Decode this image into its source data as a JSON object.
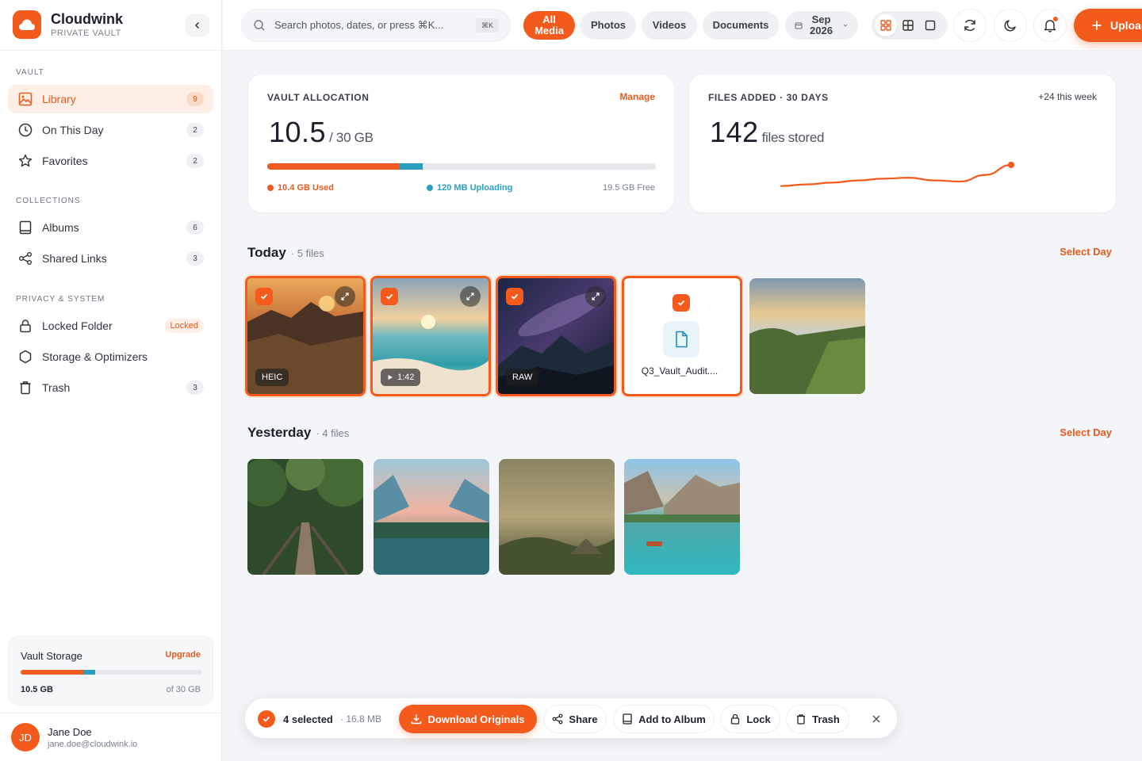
{
  "brand": {
    "name": "Cloudwink",
    "subtitle": "PRIVATE VAULT"
  },
  "sidebar": {
    "sections": [
      {
        "label": "VAULT"
      },
      {
        "label": "COLLECTIONS"
      },
      {
        "label": "PRIVACY & SYSTEM"
      }
    ],
    "items": [
      {
        "label": "Library",
        "badge": "9",
        "icon": "image-icon",
        "active": true
      },
      {
        "label": "On This Day",
        "badge": "2",
        "icon": "clock-icon"
      },
      {
        "label": "Favorites",
        "badge": "2",
        "icon": "star-icon"
      },
      {
        "label": "Albums",
        "badge": "6",
        "icon": "album-icon"
      },
      {
        "label": "Shared Links",
        "badge": "3",
        "icon": "share-icon"
      },
      {
        "label": "Locked Folder",
        "badge": "Locked",
        "icon": "lock-icon"
      },
      {
        "label": "Storage & Optimizers",
        "icon": "hexagon-icon"
      },
      {
        "label": "Trash",
        "badge": "3",
        "icon": "trash-icon"
      }
    ],
    "storage": {
      "title": "Vault Storage",
      "upgrade": "Upgrade",
      "used_label": "10.5 GB",
      "total_label": "of 30 GB",
      "used_fraction": 0.35,
      "uploading_fraction": 0.06
    },
    "user": {
      "initials": "JD",
      "name": "Jane Doe",
      "email": "jane.doe@cloudwink.io"
    }
  },
  "topbar": {
    "search_placeholder": "Search photos, dates, or press ⌘K...",
    "shortcut": "⌘K",
    "filters": [
      {
        "line1": "All",
        "line2": "Media",
        "active": true
      },
      {
        "label": "Photos"
      },
      {
        "label": "Videos"
      },
      {
        "label": "Documents"
      }
    ],
    "date": {
      "month": "Sep",
      "year": "2026"
    },
    "upload_label": "Upload"
  },
  "allocation": {
    "label": "VAULT ALLOCATION",
    "manage": "Manage",
    "value": "10.5",
    "unit": "/ 30 GB",
    "used_label": "10.4 GB Used",
    "uploading_label": "120 MB Uploading",
    "free_label": "19.5 GB Free",
    "used_fraction": 0.34,
    "uploading_fraction": 0.06
  },
  "files_added": {
    "label": "FILES ADDED · 30 DAYS",
    "meta": "+24 this week",
    "value": "142",
    "unit": "files stored",
    "trend": [
      0.05,
      0.12,
      0.2,
      0.3,
      0.38,
      0.42,
      0.3,
      0.25,
      0.55,
      1.0
    ]
  },
  "days": [
    {
      "title": "Today",
      "count": "· 5 files",
      "select": "Select Day"
    },
    {
      "title": "Yesterday",
      "count": "· 4 files",
      "select": "Select Day"
    }
  ],
  "today_items": [
    {
      "tag": "HEIC",
      "selected": true
    },
    {
      "tag": "1:42",
      "selected": true
    },
    {
      "tag": "RAW",
      "selected": true
    },
    {
      "doc_name": "Q3_Vault_Audit....",
      "selected": true
    },
    {
      "selected": false
    }
  ],
  "actionbar": {
    "selected": "4 selected",
    "size": "· 16.8 MB",
    "download": "Download Originals",
    "share": "Share",
    "add_album": "Add to Album",
    "lock": "Lock",
    "trash": "Trash"
  },
  "colors": {
    "accent": "#f35a1c",
    "uploading": "#2a9fbf"
  }
}
